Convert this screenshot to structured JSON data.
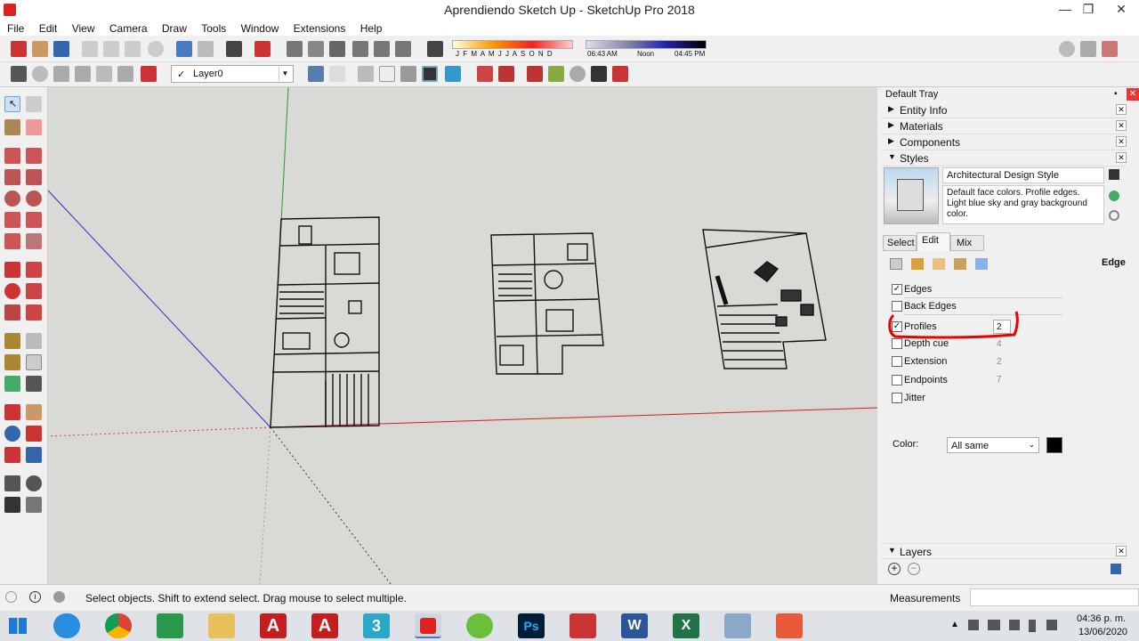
{
  "window": {
    "title": "Aprendiendo Sketch Up - SketchUp Pro 2018",
    "min": "—",
    "max": "❐",
    "close": "✕"
  },
  "menu": [
    "File",
    "Edit",
    "View",
    "Camera",
    "Draw",
    "Tools",
    "Window",
    "Extensions",
    "Help"
  ],
  "shadow": {
    "months": "J F M A M J J A S O N D",
    "time1": "06:43 AM",
    "noon": "Noon",
    "time2": "04:45 PM"
  },
  "layer_select": {
    "check": "✓",
    "value": "Layer0"
  },
  "tray": {
    "title": "Default Tray",
    "panels": [
      {
        "label": "Entity Info"
      },
      {
        "label": "Materials"
      },
      {
        "label": "Components"
      },
      {
        "label": "Styles"
      }
    ],
    "style_name": "Architectural Design Style",
    "style_desc": "Default face colors. Profile edges. Light blue sky and gray background color.",
    "tabs": [
      "Select",
      "Edit",
      "Mix"
    ],
    "edge_label": "Edge",
    "options": [
      {
        "label": "Edges",
        "checked": true,
        "value": ""
      },
      {
        "label": "Back Edges",
        "checked": false,
        "value": ""
      },
      {
        "label": "Profiles",
        "checked": true,
        "value": "2"
      },
      {
        "label": "Depth cue",
        "checked": false,
        "value": "4"
      },
      {
        "label": "Extension",
        "checked": false,
        "value": "2"
      },
      {
        "label": "Endpoints",
        "checked": false,
        "value": "7"
      },
      {
        "label": "Jitter",
        "checked": false,
        "value": ""
      }
    ],
    "color_label": "Color:",
    "color_value": "All same",
    "layers_label": "Layers"
  },
  "status": {
    "text": "Select objects. Shift to extend select. Drag mouse to select multiple.",
    "measurements": "Measurements"
  },
  "clock": {
    "time": "04:36 p. m.",
    "date": "13/06/2020"
  },
  "taskbar_letters": {
    "autocad1": "A",
    "autocad2": "A",
    "three": "3",
    "ps": "Ps",
    "word": "W",
    "excel": "X"
  }
}
